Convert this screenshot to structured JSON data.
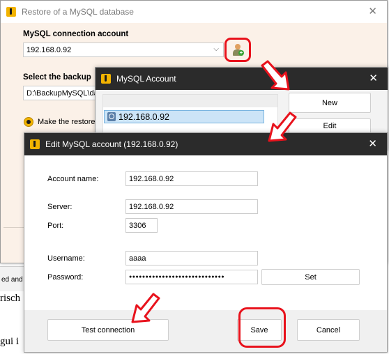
{
  "background": {
    "fragment_1": "ed and",
    "fragment_2": "risch",
    "fragment_3": "gui i"
  },
  "restore_window": {
    "title": "Restore of a MySQL database",
    "connection_label": "MySQL connection account",
    "connection_value": "192.168.0.92",
    "backup_label": "Select the backup",
    "backup_path": "D:\\BackupMySQL\\dat",
    "restore_option_label": "Make the restore"
  },
  "account_window": {
    "title": "MySQL Account",
    "list_item": "192.168.0.92",
    "new_label": "New",
    "edit_label": "Edit"
  },
  "edit_window": {
    "title": "Edit MySQL account (192.168.0.92)",
    "account_name_label": "Account name:",
    "account_name_value": "192.168.0.92",
    "server_label": "Server:",
    "server_value": "192.168.0.92",
    "port_label": "Port:",
    "port_value": "3306",
    "username_label": "Username:",
    "username_value": "aaaa",
    "password_label": "Password:",
    "password_value": "●●●●●●●●●●●●●●●●●●●●●●●●●●●●●",
    "set_label": "Set",
    "test_label": "Test connection",
    "save_label": "Save",
    "cancel_label": "Cancel"
  },
  "colors": {
    "restore_bg": "#fbf1e8",
    "title_dark": "#2b2b2b",
    "highlight_red": "#e8121c",
    "selection_blue": "#cce4f7",
    "radio_yellow": "#f2b300"
  }
}
